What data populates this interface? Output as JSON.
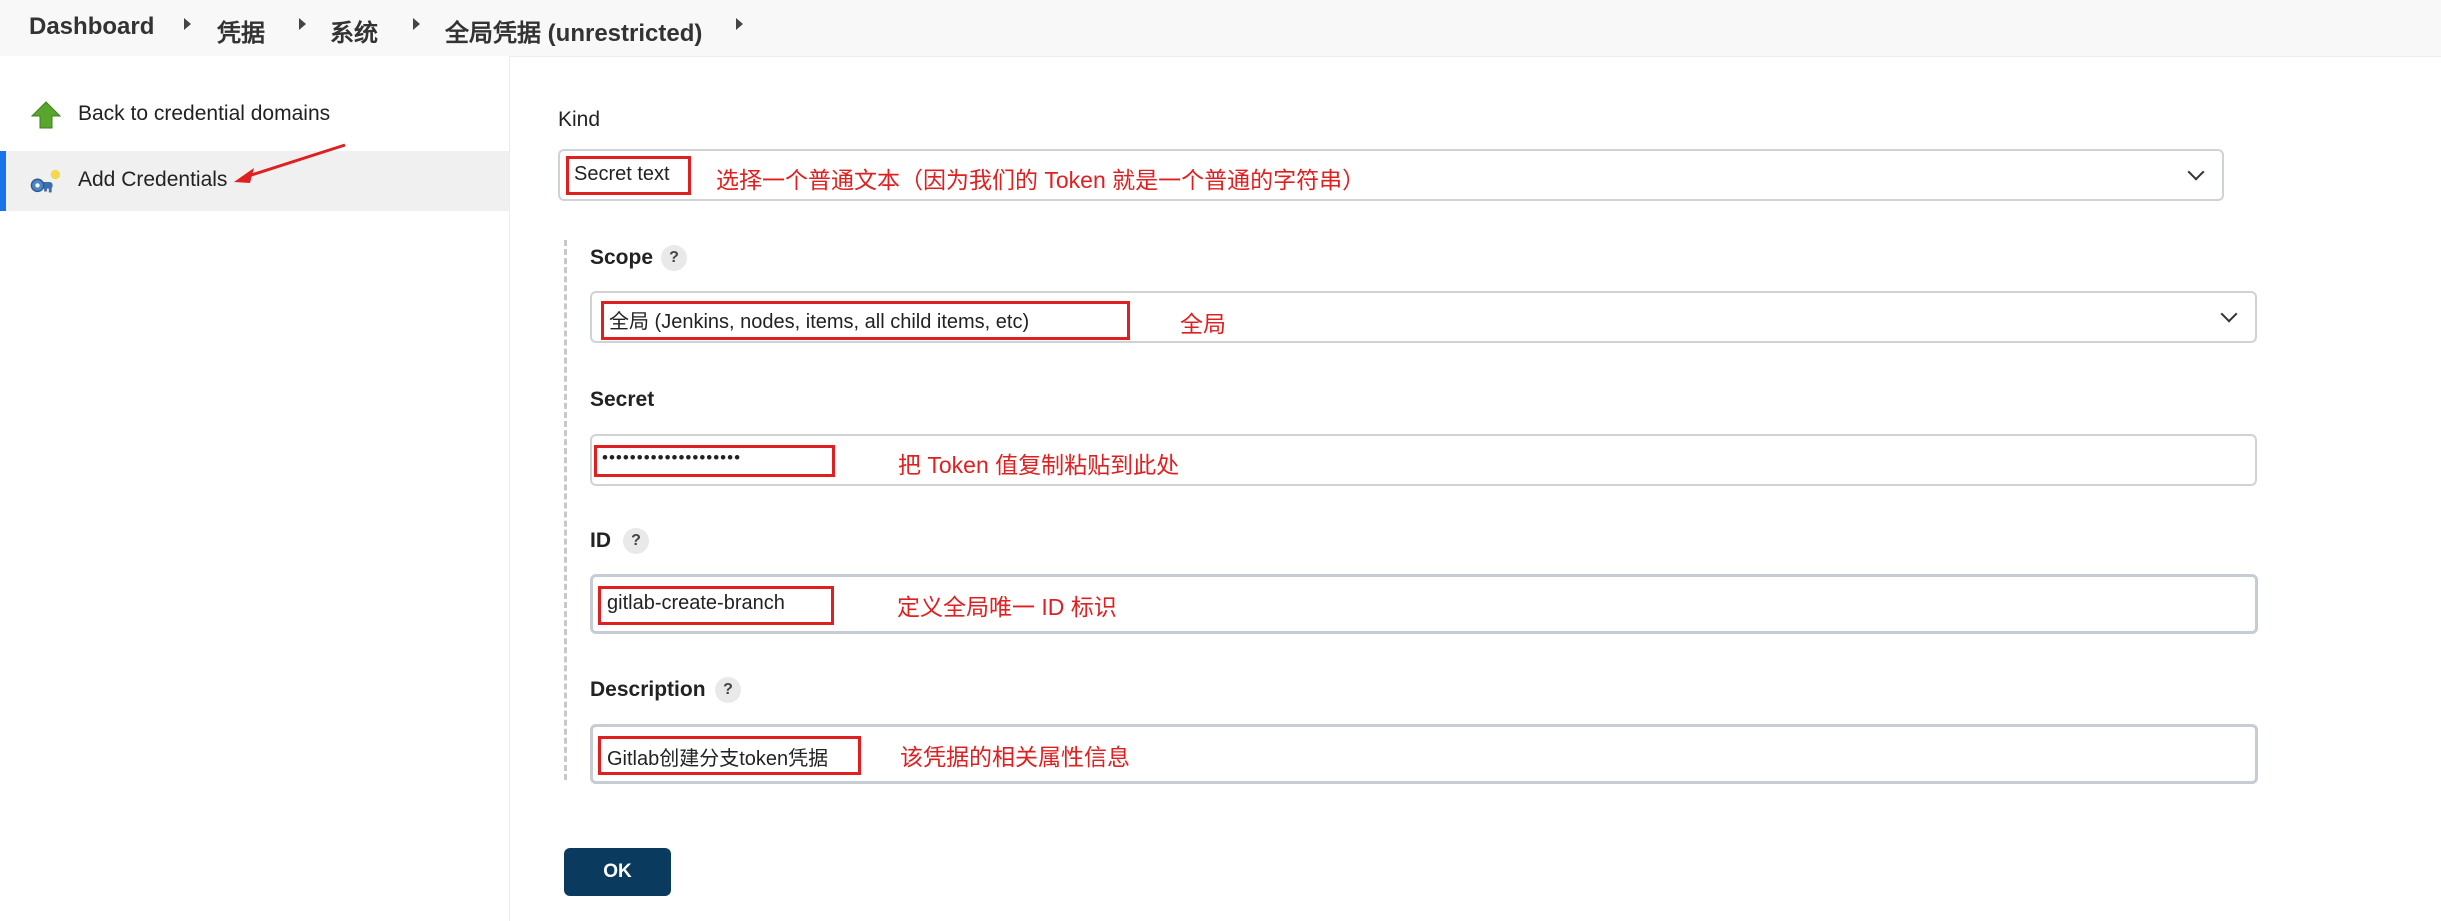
{
  "breadcrumb": {
    "items": [
      "Dashboard",
      "凭据",
      "系统",
      "全局凭据 (unrestricted)"
    ]
  },
  "sidebar": {
    "items": [
      {
        "label": "Back to credential domains",
        "icon": "up-arrow-icon"
      },
      {
        "label": "Add Credentials",
        "icon": "key-icon",
        "active": true
      }
    ]
  },
  "form": {
    "kind": {
      "label": "Kind",
      "value": "Secret text",
      "note": "选择一个普通文本（因为我们的 Token 就是一个普通的字符串）"
    },
    "scope": {
      "label": "Scope",
      "help": "?",
      "value": "全局 (Jenkins, nodes, items, all child items, etc)",
      "note": "全局"
    },
    "secret": {
      "label": "Secret",
      "value": "••••••••••••••••••••",
      "note": "把 Token 值复制粘贴到此处"
    },
    "id": {
      "label": "ID",
      "help": "?",
      "value": "gitlab-create-branch",
      "note": "定义全局唯一 ID 标识"
    },
    "description": {
      "label": "Description",
      "help": "?",
      "value": "Gitlab创建分支token凭据",
      "note": "该凭据的相关属性信息"
    },
    "ok_label": "OK"
  },
  "colors": {
    "accent": "#1a73e8",
    "annotation": "#e02020",
    "ok_button": "#0b3a5f"
  }
}
